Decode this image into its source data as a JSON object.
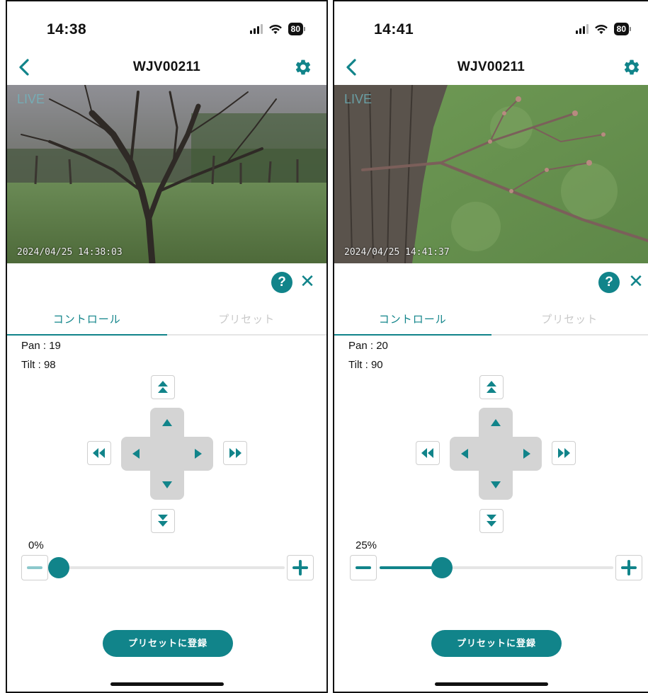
{
  "screens": [
    {
      "status": {
        "time": "14:38",
        "battery": "80"
      },
      "nav": {
        "title": "WJV00211"
      },
      "video": {
        "live_label": "LIVE",
        "timestamp": "2024/04/25 14:38:03"
      },
      "tabs": {
        "control": "コントロール",
        "preset": "プリセット"
      },
      "pan": {
        "label": "Pan : ",
        "value": "19"
      },
      "tilt": {
        "label": "Tilt  : ",
        "value": "98"
      },
      "zoom": {
        "label": "0%",
        "level": 0
      },
      "preset_button": "プリセットに登録"
    },
    {
      "status": {
        "time": "14:41",
        "battery": "80"
      },
      "nav": {
        "title": "WJV00211"
      },
      "video": {
        "live_label": "LIVE",
        "timestamp": "2024/04/25 14:41:37"
      },
      "tabs": {
        "control": "コントロール",
        "preset": "プリセット"
      },
      "pan": {
        "label": "Pan : ",
        "value": "20"
      },
      "tilt": {
        "label": "Tilt  : ",
        "value": "90"
      },
      "zoom": {
        "label": "25%",
        "level": 0.25
      },
      "preset_button": "プリセットに登録"
    }
  ],
  "colors": {
    "accent": "#11848a",
    "dpad": "#d4d4d4",
    "track": "#e5e5e5"
  },
  "icons": [
    "back-chevron-icon",
    "gear-icon",
    "help-icon",
    "close-icon",
    "signal-icon",
    "wifi-icon",
    "battery-icon"
  ]
}
